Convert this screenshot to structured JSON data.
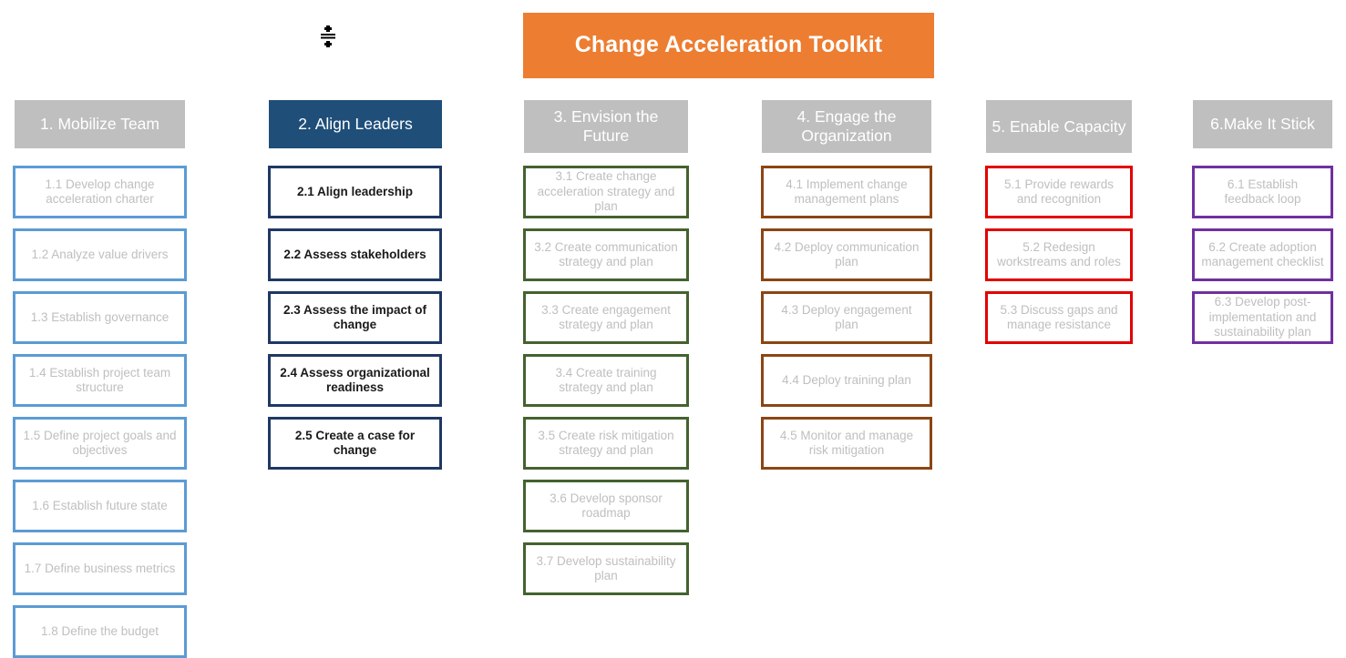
{
  "banner": {
    "title": "Change Acceleration Toolkit",
    "background_color": "#ED7D31",
    "text_color": "#FFFFFF"
  },
  "cursor": {
    "name": "vertical-resize-cursor"
  },
  "columns": [
    {
      "id": "mobilize-team",
      "header": "1. Mobilize Team",
      "header_style": "grey",
      "header_color": "#BFBFBF",
      "border_color": "#5B9BD5",
      "active": false,
      "items": [
        "1.1 Develop change acceleration charter",
        "1.2 Analyze value drivers",
        "1.3 Establish governance",
        "1.4 Establish project team structure",
        "1.5 Define project goals and objectives",
        "1.6 Establish future state",
        "1.7 Define business metrics",
        "1.8 Define the budget"
      ]
    },
    {
      "id": "align-leaders",
      "header": "2. Align Leaders",
      "header_style": "navy",
      "header_color": "#1F4E79",
      "border_color": "#1F3864",
      "active": true,
      "items": [
        "2.1 Align leadership",
        "2.2 Assess stakeholders",
        "2.3 Assess the impact of change",
        "2.4 Assess organizational readiness",
        "2.5 Create a case for change"
      ]
    },
    {
      "id": "envision-the-future",
      "header": "3. Envision the Future",
      "header_style": "grey",
      "header_color": "#BFBFBF",
      "border_color": "#44622F",
      "active": false,
      "items": [
        "3.1 Create change acceleration strategy and plan",
        "3.2 Create communication strategy and plan",
        "3.3 Create engagement strategy and plan",
        "3.4 Create training strategy and plan",
        "3.5 Create risk mitigation strategy and plan",
        "3.6 Develop sponsor roadmap",
        "3.7 Develop sustainability plan"
      ]
    },
    {
      "id": "engage-the-organization",
      "header": "4. Engage the Organization",
      "header_style": "grey",
      "header_color": "#BFBFBF",
      "border_color": "#8B4513",
      "active": false,
      "items": [
        "4.1 Implement change management plans",
        "4.2 Deploy communication plan",
        "4.3 Deploy engagement plan",
        "4.4 Deploy training plan",
        "4.5 Monitor and manage risk mitigation"
      ]
    },
    {
      "id": "enable-capacity",
      "header": "5. Enable Capacity",
      "header_style": "grey",
      "header_color": "#BFBFBF",
      "border_color": "#E30000",
      "active": false,
      "items": [
        "5.1 Provide rewards and recognition",
        "5.2 Redesign workstreams and roles",
        "5.3 Discuss gaps and manage resistance"
      ]
    },
    {
      "id": "make-it-stick",
      "header": "6.Make It Stick",
      "header_style": "grey",
      "header_color": "#BFBFBF",
      "border_color": "#7030A0",
      "active": false,
      "items": [
        "6.1 Establish feedback loop",
        "6.2 Create adoption management checklist",
        "6.3 Develop post-implementation and sustainability plan"
      ]
    }
  ]
}
